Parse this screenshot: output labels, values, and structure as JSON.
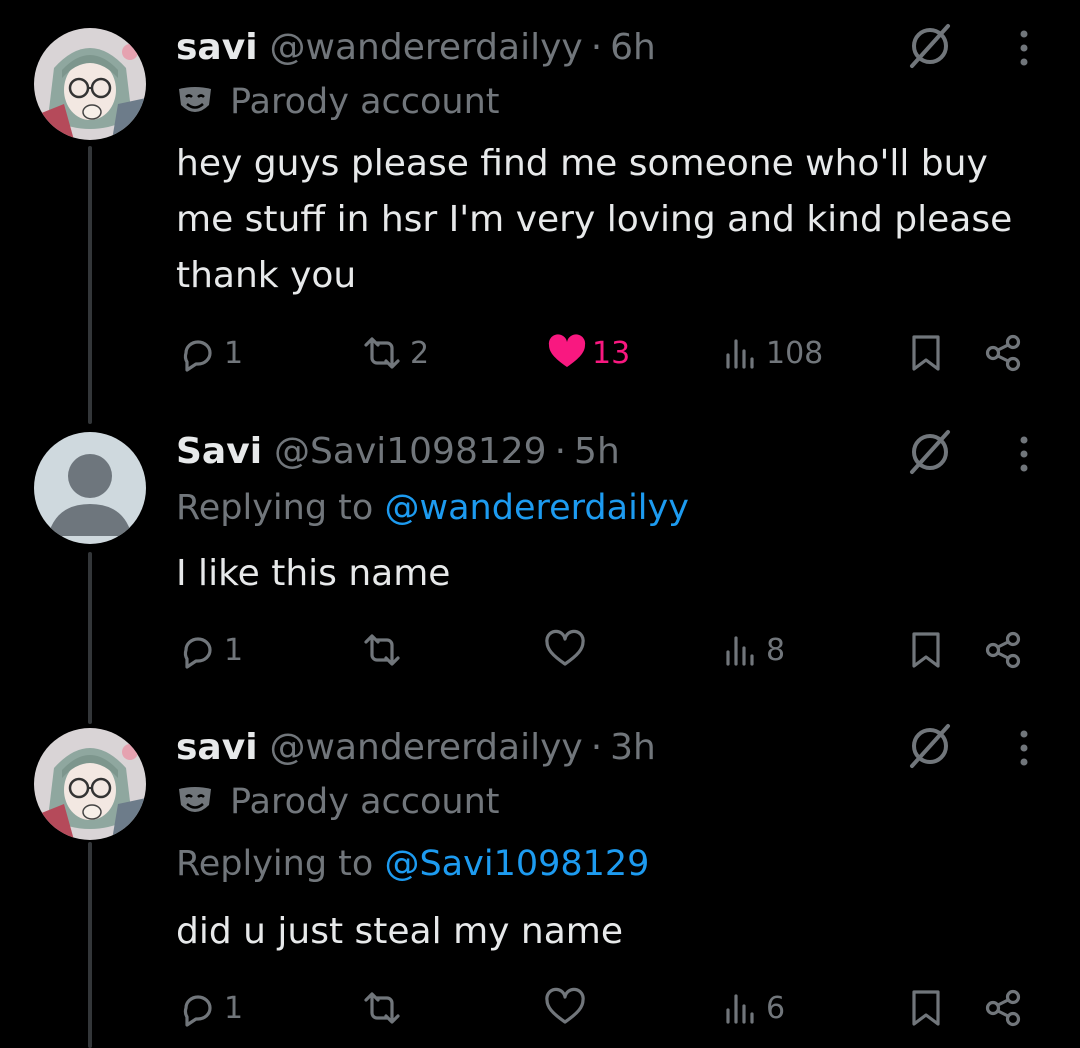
{
  "tweets": [
    {
      "name": "savi",
      "handle": "@wandererdailyy",
      "separator": "·",
      "time": "6h",
      "parody_label": "Parody account",
      "replying_prefix": "",
      "replying_to": "",
      "text_lines": [
        "hey guys please find me someone who'll buy",
        "me stuff in hsr I'm very loving and kind please",
        "thank you"
      ],
      "replies": "1",
      "reposts": "2",
      "likes": "13",
      "liked": true,
      "views": "108",
      "avatar": "anime-avatar"
    },
    {
      "name": "Savi",
      "handle": "@Savi1098129",
      "separator": "·",
      "time": "5h",
      "parody_label": "",
      "replying_prefix": "Replying to",
      "replying_to": "@wandererdailyy",
      "text_lines": [
        "I like this name"
      ],
      "replies": "1",
      "reposts": "",
      "likes": "",
      "liked": false,
      "views": "8",
      "avatar": "default-avatar"
    },
    {
      "name": "savi",
      "handle": "@wandererdailyy",
      "separator": "·",
      "time": "3h",
      "parody_label": "Parody account",
      "replying_prefix": "Replying to",
      "replying_to": "@Savi1098129",
      "text_lines": [
        "did u just steal my name"
      ],
      "replies": "1",
      "reposts": "",
      "likes": "",
      "liked": false,
      "views": "6",
      "avatar": "anime-avatar"
    }
  ],
  "colors": {
    "background": "#000000",
    "text": "#e7e9ea",
    "muted": "#71767b",
    "link": "#1d9bf0",
    "like": "#f91880",
    "thread_line": "#333639"
  },
  "icons": [
    "reply-icon",
    "repost-icon",
    "like-icon",
    "views-icon",
    "bookmark-icon",
    "share-icon",
    "grok-icon",
    "more-icon",
    "parody-mask-icon"
  ]
}
